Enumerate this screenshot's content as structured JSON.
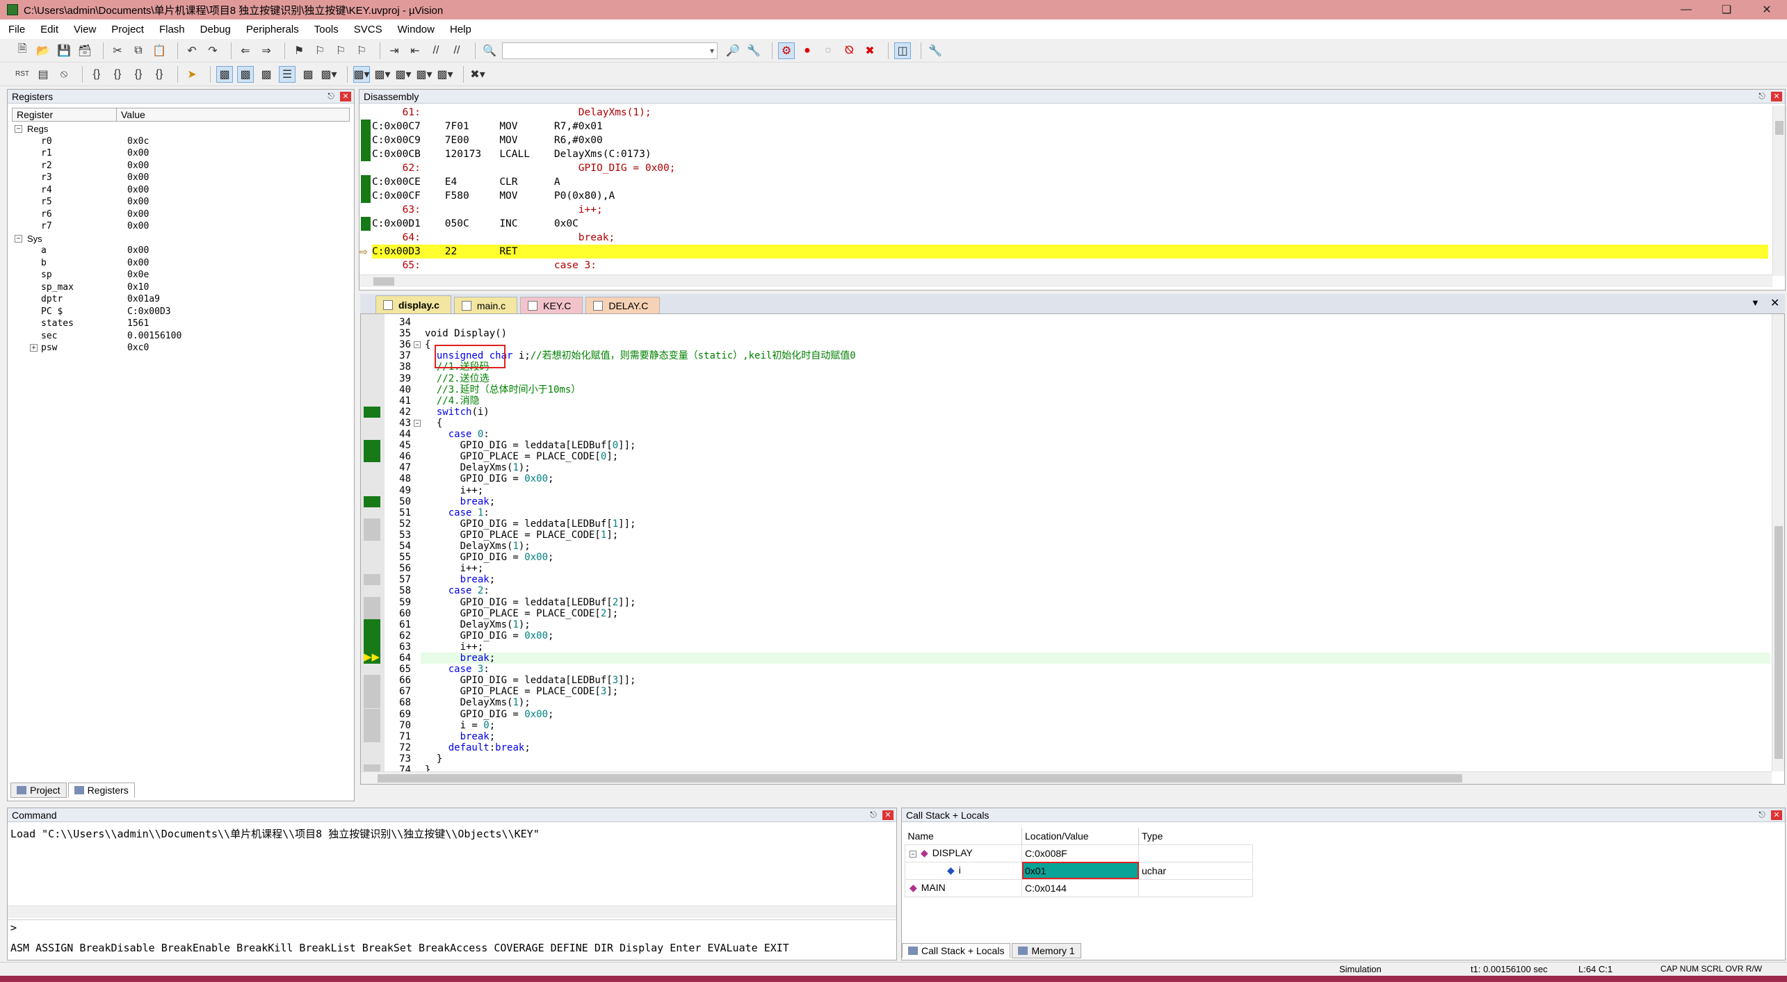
{
  "window": {
    "title": "C:\\Users\\admin\\Documents\\单片机课程\\项目8 独立按键识别\\独立按键\\KEY.uvproj - µVision"
  },
  "menu": [
    "File",
    "Edit",
    "View",
    "Project",
    "Flash",
    "Debug",
    "Peripherals",
    "Tools",
    "SVCS",
    "Window",
    "Help"
  ],
  "registers": {
    "title": "Registers",
    "col_register": "Register",
    "col_value": "Value",
    "regs_label": "Regs",
    "regs": [
      {
        "n": "r0",
        "v": "0x0c"
      },
      {
        "n": "r1",
        "v": "0x00"
      },
      {
        "n": "r2",
        "v": "0x00"
      },
      {
        "n": "r3",
        "v": "0x00"
      },
      {
        "n": "r4",
        "v": "0x00"
      },
      {
        "n": "r5",
        "v": "0x00"
      },
      {
        "n": "r6",
        "v": "0x00"
      },
      {
        "n": "r7",
        "v": "0x00"
      }
    ],
    "sys_label": "Sys",
    "sys": [
      {
        "n": "a",
        "v": "0x00"
      },
      {
        "n": "b",
        "v": "0x00"
      },
      {
        "n": "sp",
        "v": "0x0e"
      },
      {
        "n": "sp_max",
        "v": "0x10"
      },
      {
        "n": "dptr",
        "v": "0x01a9"
      },
      {
        "n": "PC  $",
        "v": "C:0x00D3"
      },
      {
        "n": "states",
        "v": "1561"
      },
      {
        "n": "sec",
        "v": "0.00156100"
      },
      {
        "n": "psw",
        "v": "0xc0"
      }
    ],
    "tab_project": "Project",
    "tab_registers": "Registers"
  },
  "disassembly": {
    "title": "Disassembly",
    "lines": [
      {
        "t": "     61:                          DelayXms(1);",
        "src": true
      },
      {
        "t": "C:0x00C7    7F01     MOV      R7,#0x01",
        "mark": true
      },
      {
        "t": "C:0x00C9    7E00     MOV      R6,#0x00",
        "mark": true
      },
      {
        "t": "C:0x00CB    120173   LCALL    DelayXms(C:0173)",
        "mark": true
      },
      {
        "t": "     62:                          GPIO_DIG = 0x00;",
        "src": true
      },
      {
        "t": "C:0x00CE    E4       CLR      A",
        "mark": true
      },
      {
        "t": "C:0x00CF    F580     MOV      P0(0x80),A",
        "mark": true
      },
      {
        "t": "     63:                          i++;",
        "src": true
      },
      {
        "t": "C:0x00D1    050C     INC      0x0C",
        "mark": true
      },
      {
        "t": "     64:                          break;",
        "src": true
      },
      {
        "t": "C:0x00D3    22       RET",
        "hl": true
      },
      {
        "t": "     65:                      case 3:",
        "src": true
      }
    ]
  },
  "editor": {
    "tabs": [
      {
        "label": "display.c",
        "color": "#f2e6a0"
      },
      {
        "label": "main.c",
        "color": "#f2e6a0"
      },
      {
        "label": "KEY.C",
        "color": "#f3c3cb"
      },
      {
        "label": "DELAY.C",
        "color": "#f6d2b6"
      }
    ],
    "lines": [
      {
        "n": "34",
        "html": ""
      },
      {
        "n": "35",
        "html": "void Display()"
      },
      {
        "n": "36",
        "html": "{"
      },
      {
        "n": "37",
        "html": "  <span class='kw'>unsigned char</span> i;<span class='cm'>//若想初始化赋值，则需要静态变量（static）,keil初始化时自动赋值0</span>"
      },
      {
        "n": "38",
        "html": "  <span class='cm'>//1.送段码</span>"
      },
      {
        "n": "39",
        "html": "  <span class='cm'>//2.送位选</span>"
      },
      {
        "n": "40",
        "html": "  <span class='cm'>//3.延时（总体时间小于10ms）</span>"
      },
      {
        "n": "41",
        "html": "  <span class='cm'>//4.消隐</span>"
      },
      {
        "n": "42",
        "html": "  <span class='kw'>switch</span>(i)",
        "g": "green"
      },
      {
        "n": "43",
        "html": "  {"
      },
      {
        "n": "44",
        "html": "    <span class='kw'>case</span> <span class='num'>0</span>:"
      },
      {
        "n": "45",
        "html": "      GPIO_DIG = leddata[LEDBuf[<span class='num'>0</span>]];",
        "g": "green"
      },
      {
        "n": "46",
        "html": "      GPIO_PLACE = PLACE_CODE[<span class='num'>0</span>];",
        "g": "green"
      },
      {
        "n": "47",
        "html": "      DelayXms(<span class='num'>1</span>);"
      },
      {
        "n": "48",
        "html": "      GPIO_DIG = <span class='num'>0x00</span>;"
      },
      {
        "n": "49",
        "html": "      i++;"
      },
      {
        "n": "50",
        "html": "      <span class='kw'>break</span>;",
        "g": "green"
      },
      {
        "n": "51",
        "html": "    <span class='kw'>case</span> <span class='num'>1</span>:"
      },
      {
        "n": "52",
        "html": "      GPIO_DIG = leddata[LEDBuf[<span class='num'>1</span>]];",
        "g": "gray"
      },
      {
        "n": "53",
        "html": "      GPIO_PLACE = PLACE_CODE[<span class='num'>1</span>];",
        "g": "gray"
      },
      {
        "n": "54",
        "html": "      DelayXms(<span class='num'>1</span>);"
      },
      {
        "n": "55",
        "html": "      GPIO_DIG = <span class='num'>0x00</span>;"
      },
      {
        "n": "56",
        "html": "      i++;"
      },
      {
        "n": "57",
        "html": "      <span class='kw'>break</span>;",
        "g": "gray"
      },
      {
        "n": "58",
        "html": "    <span class='kw'>case</span> <span class='num'>2</span>:"
      },
      {
        "n": "59",
        "html": "      GPIO_DIG = leddata[LEDBuf[<span class='num'>2</span>]];",
        "g": "gray"
      },
      {
        "n": "60",
        "html": "      GPIO_PLACE = PLACE_CODE[<span class='num'>2</span>];",
        "g": "gray"
      },
      {
        "n": "61",
        "html": "      DelayXms(<span class='num'>1</span>);",
        "g": "green"
      },
      {
        "n": "62",
        "html": "      GPIO_DIG = <span class='num'>0x00</span>;",
        "g": "green"
      },
      {
        "n": "63",
        "html": "      i++;",
        "g": "green"
      },
      {
        "n": "64",
        "html": "      <span class='kw'>break</span>;",
        "g": "arrow",
        "cur": true
      },
      {
        "n": "65",
        "html": "    <span class='kw'>case</span> <span class='num'>3</span>:"
      },
      {
        "n": "66",
        "html": "      GPIO_DIG = leddata[LEDBuf[<span class='num'>3</span>]];",
        "g": "gray"
      },
      {
        "n": "67",
        "html": "      GPIO_PLACE = PLACE_CODE[<span class='num'>3</span>];",
        "g": "gray"
      },
      {
        "n": "68",
        "html": "      DelayXms(<span class='num'>1</span>);",
        "g": "gray"
      },
      {
        "n": "69",
        "html": "      GPIO_DIG = <span class='num'>0x00</span>;",
        "g": "gray"
      },
      {
        "n": "70",
        "html": "      i = <span class='num'>0</span>;",
        "g": "gray"
      },
      {
        "n": "71",
        "html": "      <span class='kw'>break</span>;",
        "g": "gray"
      },
      {
        "n": "72",
        "html": "    <span class='kw'>default</span>:<span class='kw'>break</span>;"
      },
      {
        "n": "73",
        "html": "  }"
      },
      {
        "n": "74",
        "html": "}",
        "g": "gray"
      }
    ]
  },
  "command": {
    "title": "Command",
    "text": "Load \"C:\\\\Users\\\\admin\\\\Documents\\\\单片机课程\\\\项目8 独立按键识别\\\\独立按键\\\\Objects\\\\KEY\"",
    "prompt": ">",
    "hints": "ASM ASSIGN BreakDisable BreakEnable BreakKill BreakList BreakSet BreakAccess COVERAGE DEFINE DIR Display Enter EVALuate EXIT"
  },
  "callstack": {
    "title": "Call Stack + Locals",
    "col_name": "Name",
    "col_loc": "Location/Value",
    "col_type": "Type",
    "rows": [
      {
        "name": "DISPLAY",
        "loc": "C:0x008F",
        "type": ""
      },
      {
        "name": "i",
        "loc": "0x01",
        "type": "uchar"
      },
      {
        "name": "MAIN",
        "loc": "C:0x0144",
        "type": ""
      }
    ],
    "tab_callstack": "Call Stack + Locals",
    "tab_memory": "Memory 1"
  },
  "status": {
    "mode": "Simulation",
    "time": "t1: 0.00156100 sec",
    "pos": "L:64 C:1",
    "caps": "CAP  NUM  SCRL  OVR  R/W"
  },
  "colors": {
    "title_bg": "#e09a9a",
    "exec_green": "#177a17",
    "current_line": "#ffff2e",
    "selected_cell": "#0aa397",
    "annotation_red": "#e02020"
  }
}
